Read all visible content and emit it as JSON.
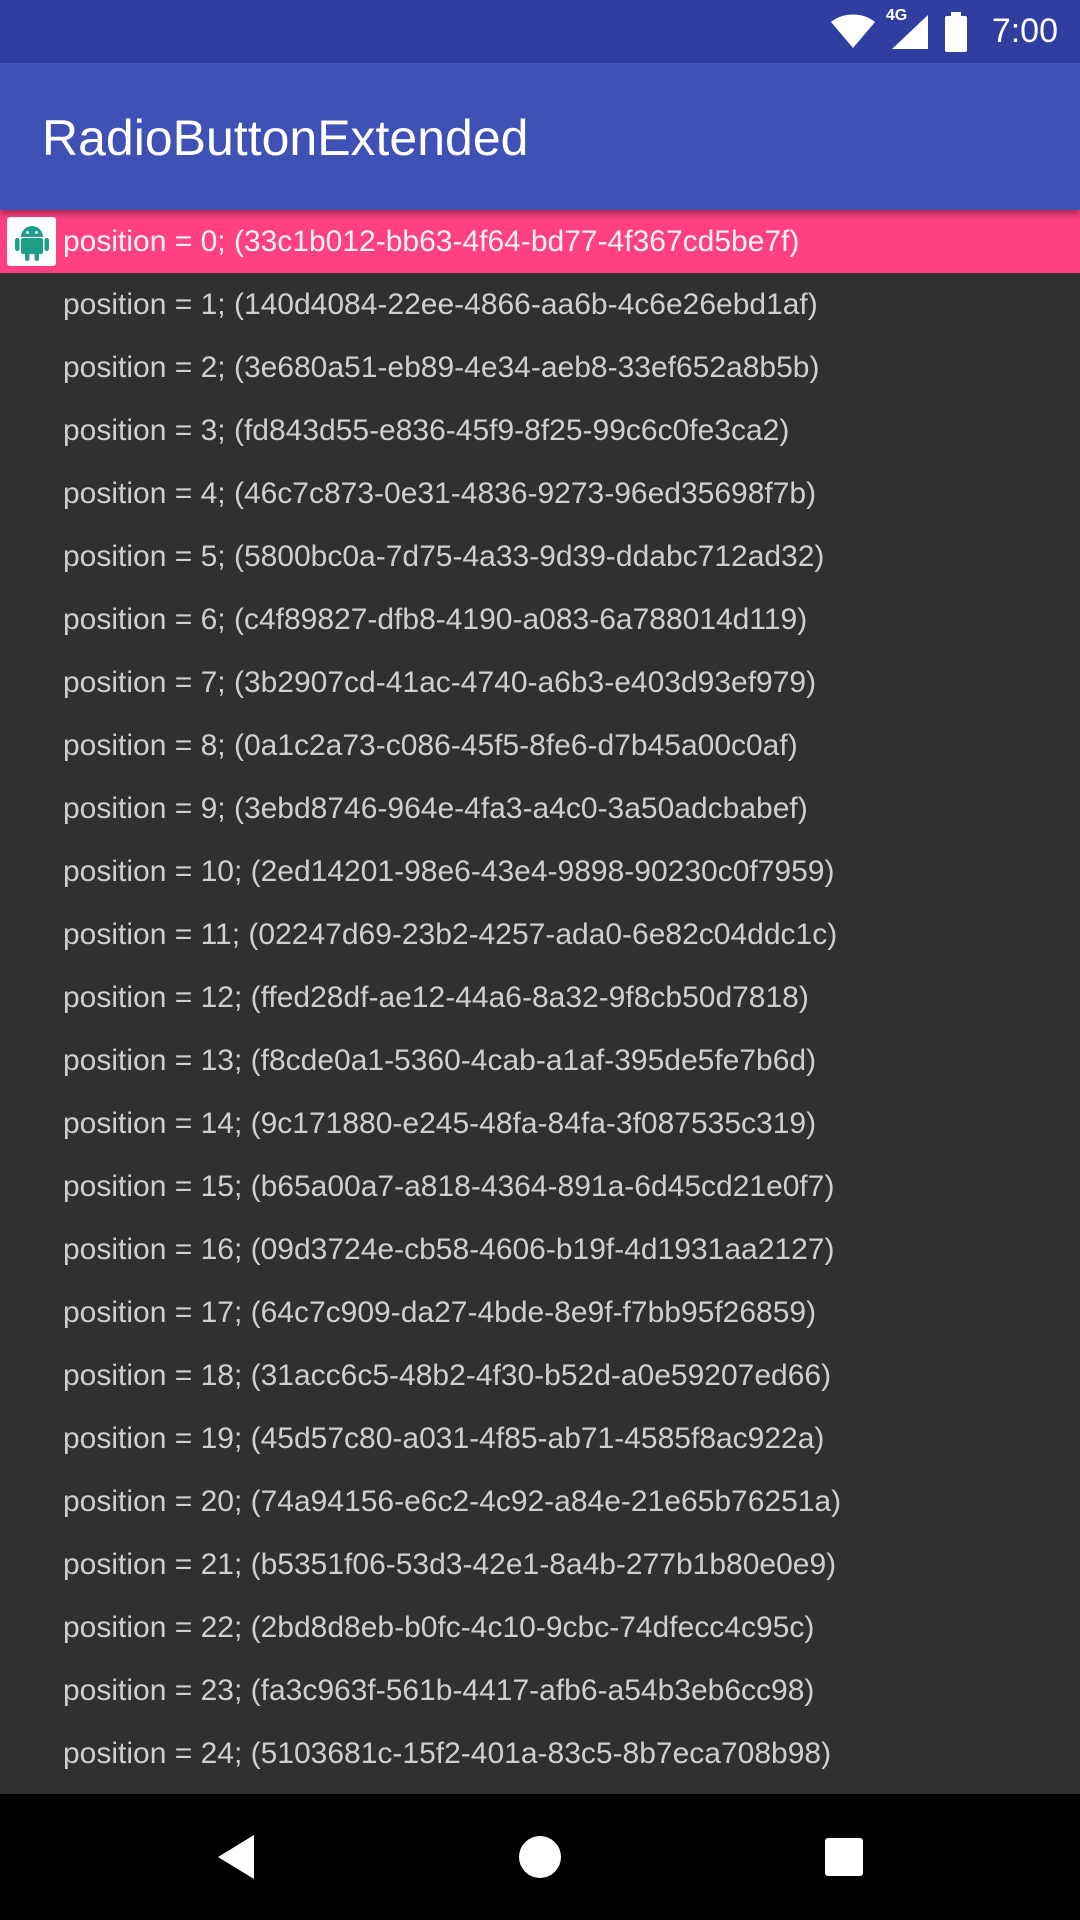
{
  "status_bar": {
    "network": "4G",
    "time": "7:00",
    "icons": [
      "wifi-icon",
      "signal-icon",
      "battery-icon"
    ]
  },
  "app_bar": {
    "title": "RadioButtonExtended"
  },
  "list": {
    "selected_index": 0,
    "items": [
      {
        "label": "position = 0; (33c1b012-bb63-4f64-bd77-4f367cd5be7f)"
      },
      {
        "label": "position = 1; (140d4084-22ee-4866-aa6b-4c6e26ebd1af)"
      },
      {
        "label": "position = 2; (3e680a51-eb89-4e34-aeb8-33ef652a8b5b)"
      },
      {
        "label": "position = 3; (fd843d55-e836-45f9-8f25-99c6c0fe3ca2)"
      },
      {
        "label": "position = 4; (46c7c873-0e31-4836-9273-96ed35698f7b)"
      },
      {
        "label": "position = 5; (5800bc0a-7d75-4a33-9d39-ddabc712ad32)"
      },
      {
        "label": "position = 6; (c4f89827-dfb8-4190-a083-6a788014d119)"
      },
      {
        "label": "position = 7; (3b2907cd-41ac-4740-a6b3-e403d93ef979)"
      },
      {
        "label": "position = 8; (0a1c2a73-c086-45f5-8fe6-d7b45a00c0af)"
      },
      {
        "label": "position = 9; (3ebd8746-964e-4fa3-a4c0-3a50adcbabef)"
      },
      {
        "label": "position = 10; (2ed14201-98e6-43e4-9898-90230c0f7959)"
      },
      {
        "label": "position = 11; (02247d69-23b2-4257-ada0-6e82c04ddc1c)"
      },
      {
        "label": "position = 12; (ffed28df-ae12-44a6-8a32-9f8cb50d7818)"
      },
      {
        "label": "position = 13; (f8cde0a1-5360-4cab-a1af-395de5fe7b6d)"
      },
      {
        "label": "position = 14; (9c171880-e245-48fa-84fa-3f087535c319)"
      },
      {
        "label": "position = 15; (b65a00a7-a818-4364-891a-6d45cd21e0f7)"
      },
      {
        "label": "position = 16; (09d3724e-cb58-4606-b19f-4d1931aa2127)"
      },
      {
        "label": "position = 17; (64c7c909-da27-4bde-8e9f-f7bb95f26859)"
      },
      {
        "label": "position = 18; (31acc6c5-48b2-4f30-b52d-a0e59207ed66)"
      },
      {
        "label": "position = 19; (45d57c80-a031-4f85-ab71-4585f8ac922a)"
      },
      {
        "label": "position = 20; (74a94156-e6c2-4c92-a84e-21e65b76251a)"
      },
      {
        "label": "position = 21; (b5351f06-53d3-42e1-8a4b-277b1b80e0e9)"
      },
      {
        "label": "position = 22; (2bd8d8eb-b0fc-4c10-9cbc-74dfecc4c95c)"
      },
      {
        "label": "position = 23; (fa3c963f-561b-4417-afb6-a54b3eb6cc98)"
      },
      {
        "label": "position = 24; (5103681c-15f2-401a-83c5-8b7eca708b98)"
      }
    ]
  },
  "nav_bar": {
    "buttons": [
      "back-icon",
      "home-icon",
      "recents-icon"
    ]
  },
  "colors": {
    "status_bar": "#303F9F",
    "app_bar": "#3F51B5",
    "background": "#303030",
    "selected_row": "#FF4081",
    "android_green": "#3DDC84",
    "text": "#cfcfcf"
  }
}
